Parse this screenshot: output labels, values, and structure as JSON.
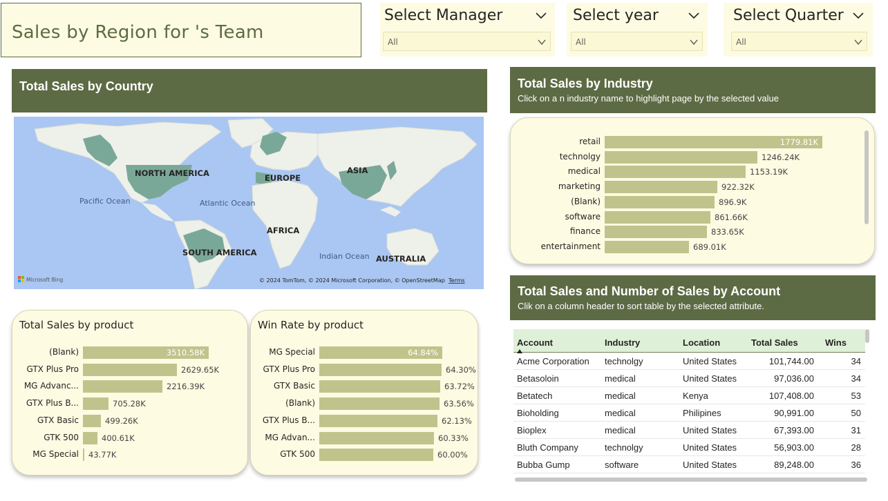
{
  "title": "Sales by Region for 's Team",
  "slicers": [
    {
      "label": "Select Manager",
      "value": "All"
    },
    {
      "label": "Select year",
      "value": "All"
    },
    {
      "label": "Select Quarter",
      "value": "All"
    }
  ],
  "country_map": {
    "title": "Total Sales by Country",
    "labels": {
      "north_america": "NORTH AMERICA",
      "europe": "EUROPE",
      "asia": "ASIA",
      "africa": "AFRICA",
      "south_america": "SOUTH AMERICA",
      "australia": "AUSTRALIA",
      "pacific": "Pacific Ocean",
      "atlantic": "Atlantic Ocean",
      "indian": "Indian Ocean"
    },
    "logo": "Microsoft Bing",
    "attribution": "© 2024 TomTom, © 2024 Microsoft Corporation, © OpenStreetMap",
    "terms": "Terms"
  },
  "industry": {
    "title": "Total Sales by Industry",
    "subtitle": "Click on a n industry name to highlight page by the selected value",
    "items": [
      {
        "label": "retail",
        "value": 1779.81,
        "text": "1779.81K"
      },
      {
        "label": "technolgy",
        "value": 1246.24,
        "text": "1246.24K"
      },
      {
        "label": "medical",
        "value": 1153.19,
        "text": "1153.19K"
      },
      {
        "label": "marketing",
        "value": 922.32,
        "text": "922.32K"
      },
      {
        "label": "(Blank)",
        "value": 896.9,
        "text": "896.9K"
      },
      {
        "label": "software",
        "value": 861.66,
        "text": "861.66K"
      },
      {
        "label": "finance",
        "value": 833.65,
        "text": "833.65K"
      },
      {
        "label": "entertainment",
        "value": 689.01,
        "text": "689.01K"
      }
    ]
  },
  "product_sales": {
    "title": "Total Sales by product",
    "items": [
      {
        "label": "(Blank)",
        "value": 3510.58,
        "text": "3510.58K"
      },
      {
        "label": "GTX Plus Pro",
        "value": 2629.65,
        "text": "2629.65K"
      },
      {
        "label": "MG Advanc...",
        "value": 2216.39,
        "text": "2216.39K"
      },
      {
        "label": "GTX Plus B...",
        "value": 705.28,
        "text": "705.28K"
      },
      {
        "label": "GTX Basic",
        "value": 499.26,
        "text": "499.26K"
      },
      {
        "label": "GTK 500",
        "value": 400.61,
        "text": "400.61K"
      },
      {
        "label": "MG Special",
        "value": 43.77,
        "text": "43.77K"
      }
    ]
  },
  "win_rate": {
    "title": "Win Rate by product",
    "items": [
      {
        "label": "MG Special",
        "value": 64.84,
        "text": "64.84%"
      },
      {
        "label": "GTX Plus Pro",
        "value": 64.3,
        "text": "64.30%"
      },
      {
        "label": "GTX Basic",
        "value": 63.72,
        "text": "63.72%"
      },
      {
        "label": "(Blank)",
        "value": 63.56,
        "text": "63.56%"
      },
      {
        "label": "GTX Plus B...",
        "value": 62.13,
        "text": "62.13%"
      },
      {
        "label": "MG Advan...",
        "value": 60.33,
        "text": "60.33%"
      },
      {
        "label": "GTK 500",
        "value": 60.0,
        "text": "60.00%"
      }
    ]
  },
  "accounts": {
    "title": "Total Sales and Number of Sales by Account",
    "subtitle": "Clik on a column header to sort table by the selected attribute.",
    "columns": [
      "Account",
      "Industry",
      "Location",
      "Total Sales",
      "Wins"
    ],
    "rows": [
      [
        "Acme Corporation",
        "technolgy",
        "United States",
        "101,744.00",
        "34"
      ],
      [
        "Betasoloin",
        "medical",
        "United States",
        "97,036.00",
        "34"
      ],
      [
        "Betatech",
        "medical",
        "Kenya",
        "107,408.00",
        "53"
      ],
      [
        "Bioholding",
        "medical",
        "Philipines",
        "90,991.00",
        "50"
      ],
      [
        "Bioplex",
        "medical",
        "United States",
        "67,393.00",
        "31"
      ],
      [
        "Bluth Company",
        "technolgy",
        "United States",
        "56,903.00",
        "28"
      ],
      [
        "Bubba Gump",
        "software",
        "United States",
        "89,248.00",
        "36"
      ]
    ]
  },
  "colors": {
    "header": "#5d6b45",
    "panel": "#fdfbe2",
    "bar": "#c0c48c",
    "table_header": "#dff0d8",
    "land_highlight": "#7aa898",
    "ocean": "#aac6f2"
  }
}
